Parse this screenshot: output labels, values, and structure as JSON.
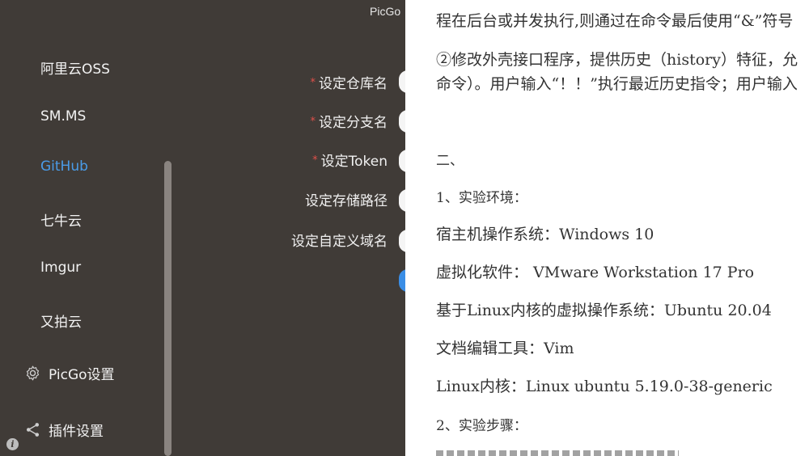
{
  "app": {
    "title": "PicGo",
    "sidebar": {
      "items": [
        {
          "label": "阿里云OSS",
          "active": false
        },
        {
          "label": "SM.MS",
          "active": false
        },
        {
          "label": "GitHub",
          "active": true
        },
        {
          "label": "七牛云",
          "active": false
        },
        {
          "label": "Imgur",
          "active": false
        },
        {
          "label": "又拍云",
          "active": false
        }
      ],
      "settings_label": "PicGo设置",
      "plugins_label": "插件设置",
      "settings_icon": "gear-icon",
      "plugins_icon": "share-icon",
      "info_icon": "info-icon",
      "info_glyph": "i"
    },
    "form": {
      "required_mark": "*",
      "fields": [
        {
          "label": "设定仓库名",
          "required": true
        },
        {
          "label": "设定分支名",
          "required": true
        },
        {
          "label": "设定Token",
          "required": true
        },
        {
          "label": "设定存储路径",
          "required": false
        },
        {
          "label": "设定自定义域名",
          "required": false
        }
      ]
    },
    "colors": {
      "sidebar_bg": "#403b37",
      "accent": "#4a9ce8",
      "required": "#e0504a",
      "button": "#3a8ee6"
    }
  },
  "document": {
    "lines": [
      "程在后台或并发执行,则通过在命令最后使用“&”符号",
      "②修改外壳接口程序，提供历史（history）特征，允",
      "命令）。用户输入“！！”执行最近历史指令；用户输入",
      "二、",
      "1、实验环境：",
      "宿主机操作系统：Windows 10",
      "虚拟化软件： VMware Workstation 17 Pro",
      "基于Linux内核的虚拟操作系统：Ubuntu 20.04",
      "文档编辑工具：Vim",
      "Linux内核：Linux ubuntu 5.19.0-38-generic",
      "2、实验步骤："
    ]
  }
}
